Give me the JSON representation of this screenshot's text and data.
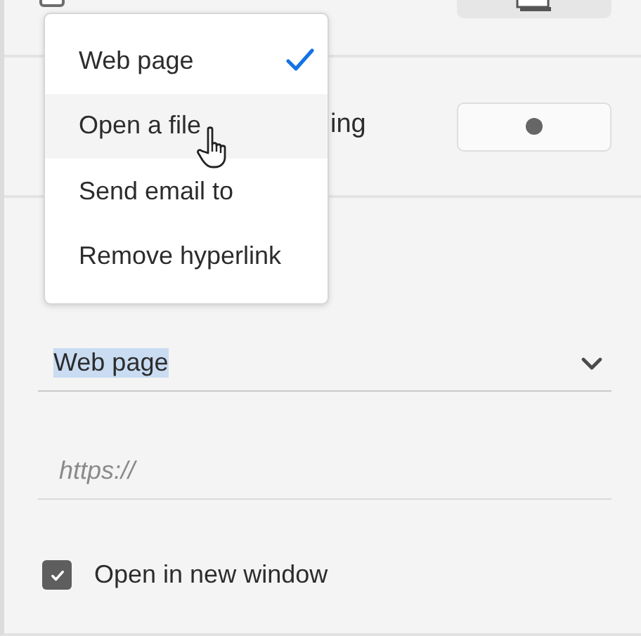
{
  "shadow_row": {
    "checked": false
  },
  "corner_row": {
    "label": "ing"
  },
  "link_type": {
    "value": "Web page",
    "highlighted": true
  },
  "url_field": {
    "placeholder": "https://"
  },
  "new_window": {
    "label": "Open in new window",
    "checked": true
  },
  "menu": {
    "items": [
      {
        "label": "Web page",
        "selected": true,
        "hovered": false
      },
      {
        "label": "Open a file",
        "selected": false,
        "hovered": true
      },
      {
        "label": "Send email to",
        "selected": false,
        "hovered": false
      },
      {
        "label": "Remove hyperlink",
        "selected": false,
        "hovered": false
      }
    ]
  }
}
